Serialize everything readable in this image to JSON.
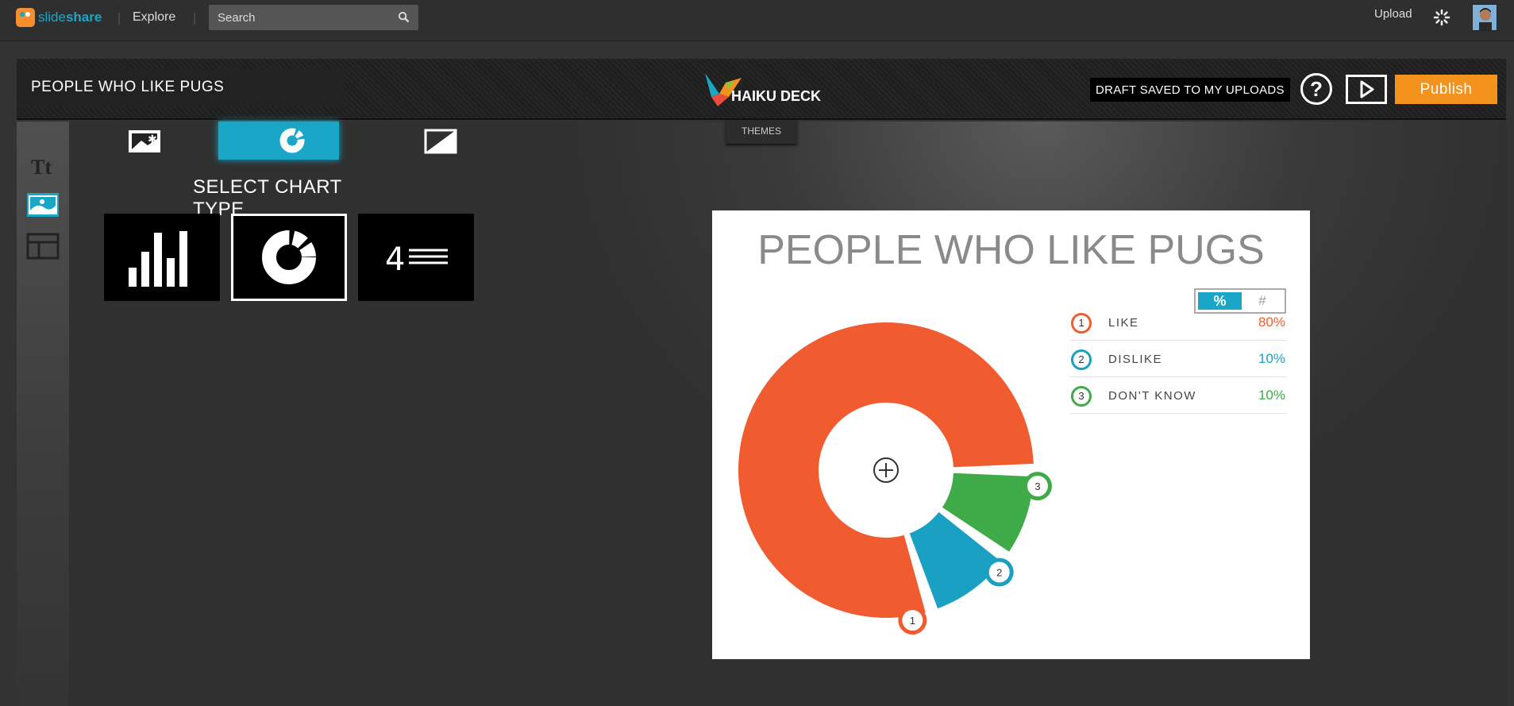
{
  "topbar": {
    "logo_a": "slide",
    "logo_b": "share",
    "explore": "Explore",
    "search_placeholder": "Search",
    "upload": "Upload"
  },
  "deckbar": {
    "title": "PEOPLE WHO LIKE PUGS",
    "brand": "HAIKU DECK",
    "draft_status": "DRAFT SAVED TO MY UPLOADS",
    "help": "?",
    "publish": "Publish",
    "themes": "THEMES"
  },
  "panel": {
    "select_chart_label": "SELECT CHART TYPE",
    "number_tile_digit": "4"
  },
  "slide": {
    "title": "PEOPLE WHO LIKE PUGS",
    "toggle_pct": "%",
    "toggle_num": "#"
  },
  "colors": {
    "accent": "#1aa7c7",
    "publish": "#f3921d",
    "like": "#f05c30",
    "dislike": "#1aa0c2",
    "dont_know": "#3faa48"
  },
  "chart_data": {
    "type": "pie",
    "style": "donut",
    "title": "PEOPLE WHO LIKE PUGS",
    "slices": [
      {
        "index": "1",
        "label": "LIKE",
        "value": 80,
        "display": "80%",
        "color": "#f05c30"
      },
      {
        "index": "2",
        "label": "DISLIKE",
        "value": 10,
        "display": "10%",
        "color": "#1aa0c2"
      },
      {
        "index": "3",
        "label": "DON'T KNOW",
        "value": 10,
        "display": "10%",
        "color": "#3faa48"
      }
    ]
  }
}
